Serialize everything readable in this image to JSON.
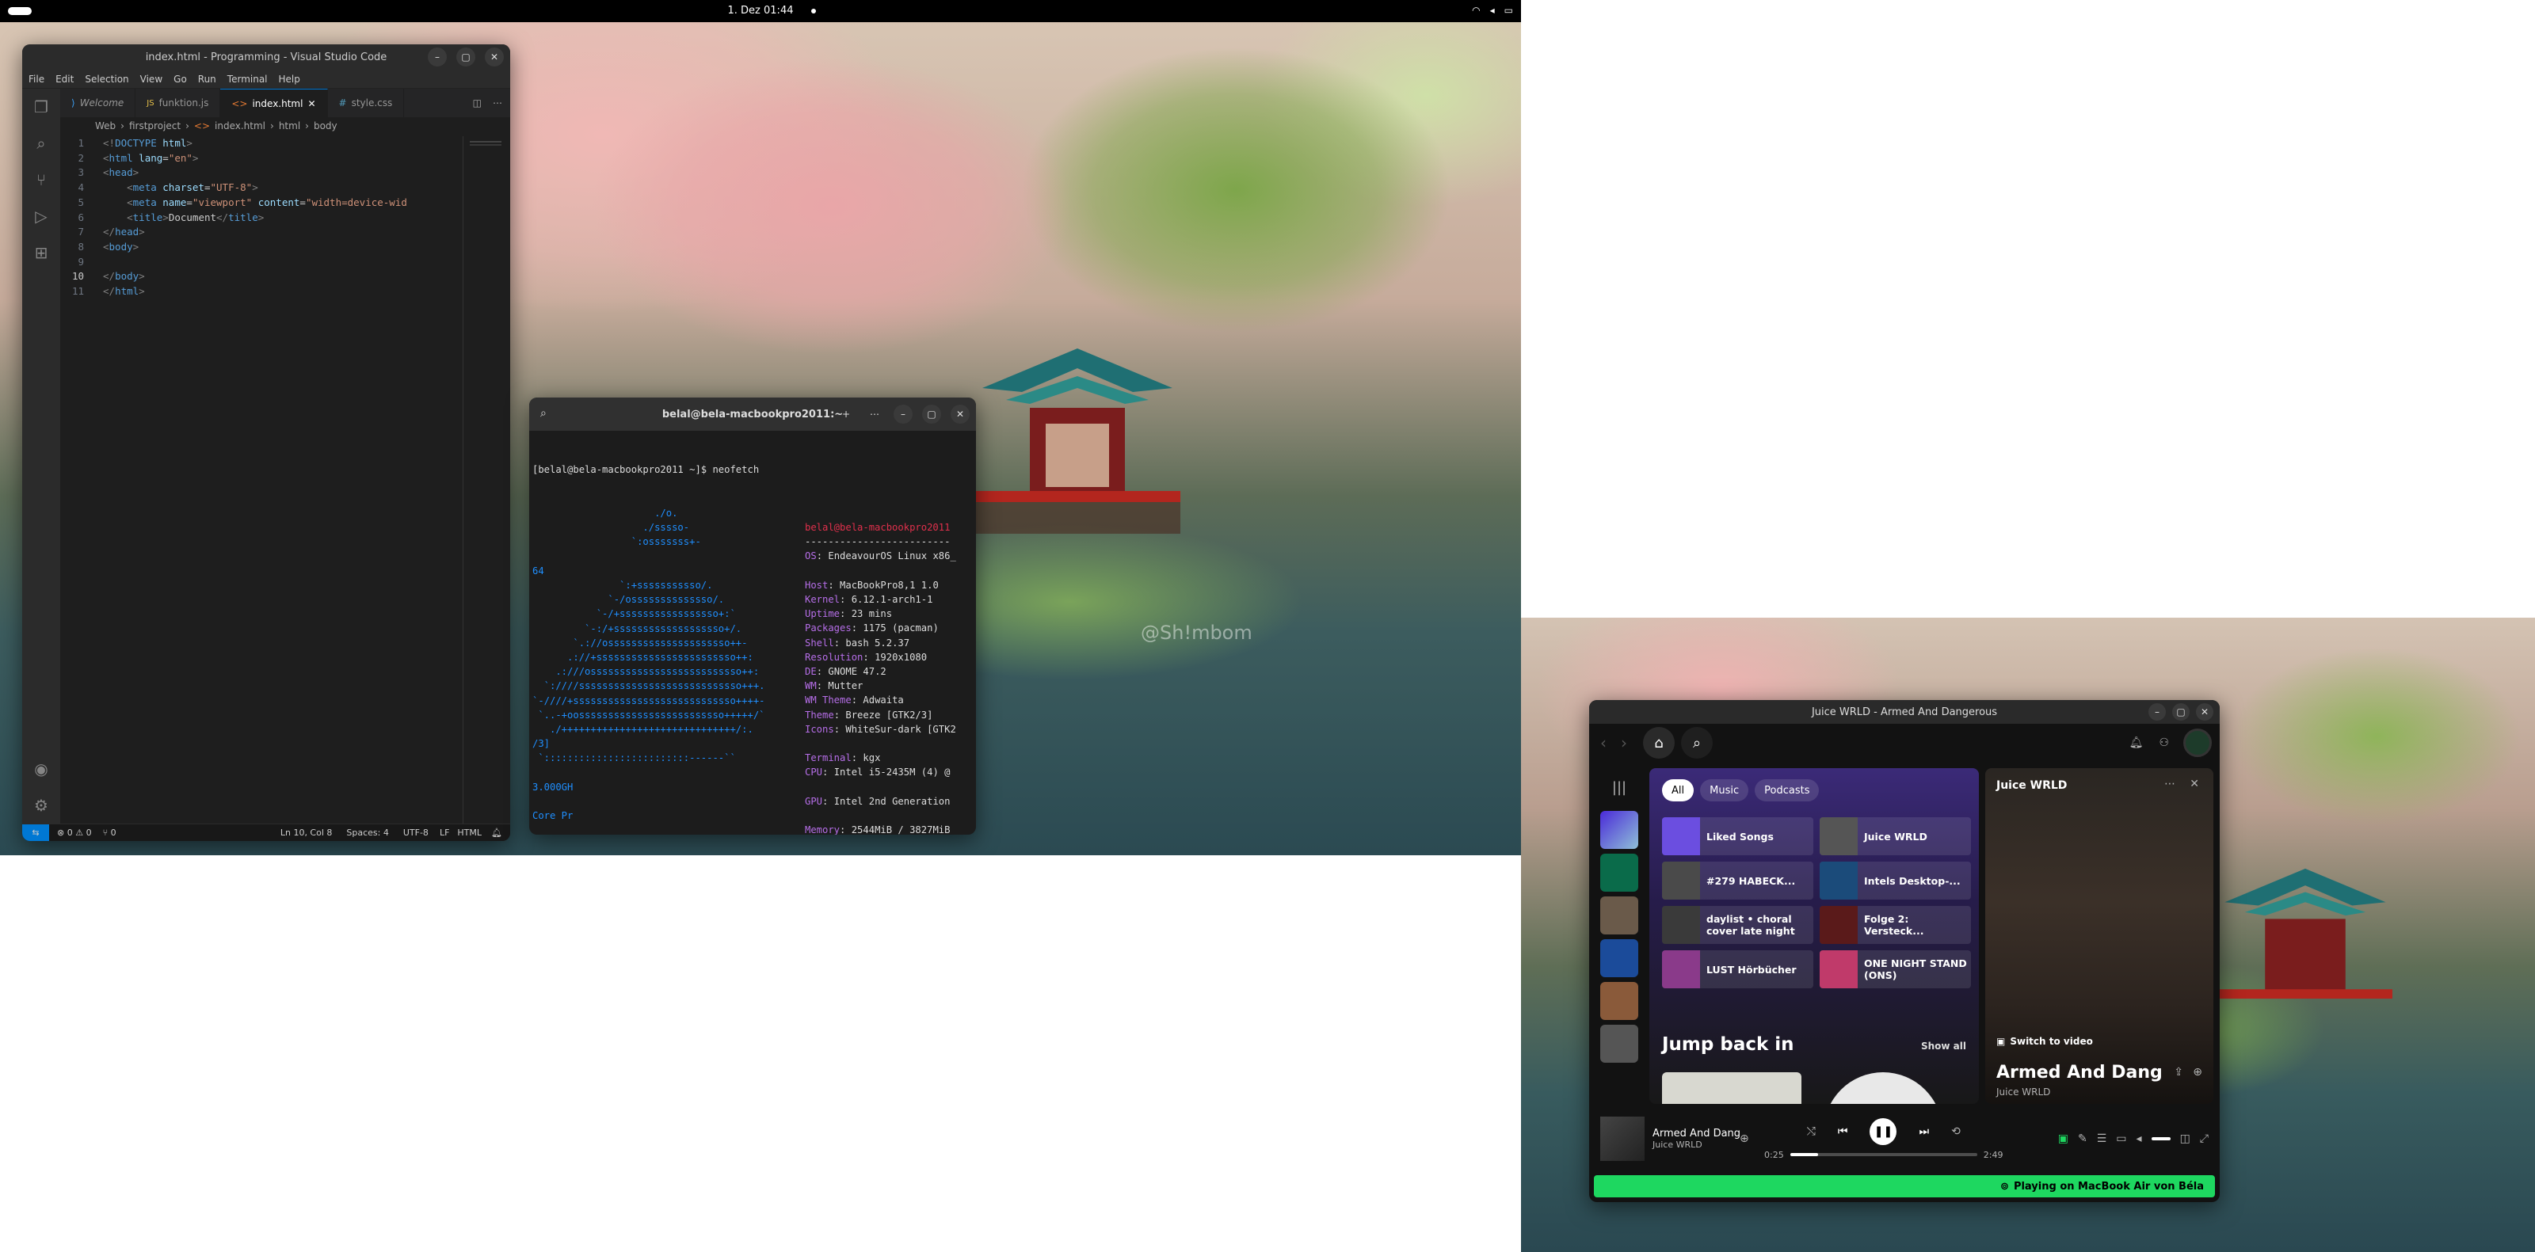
{
  "topbar": {
    "clock": "1. Dez  01:44"
  },
  "wallpaper_watermark": "@Sh!mbom",
  "vscode": {
    "title": "index.html - Programming - Visual Studio Code",
    "menu": [
      "File",
      "Edit",
      "Selection",
      "View",
      "Go",
      "Run",
      "Terminal",
      "Help"
    ],
    "tabs": [
      "Welcome",
      "funktion.js",
      "index.html",
      "style.css"
    ],
    "breadcrumb": [
      "Web",
      "firstproject",
      "index.html",
      "html",
      "body"
    ],
    "lines": [
      {
        "n": "1",
        "html": "<span class='pl'>&lt;!</span><span class='tg'>DOCTYPE</span> <span class='at'>html</span><span class='pl'>&gt;</span>"
      },
      {
        "n": "2",
        "html": "<span class='pl'>&lt;</span><span class='tg'>html</span> <span class='at'>lang</span>=<span class='st'>\"en\"</span><span class='pl'>&gt;</span>"
      },
      {
        "n": "3",
        "html": "<span class='pl'>&lt;</span><span class='tg'>head</span><span class='pl'>&gt;</span>"
      },
      {
        "n": "4",
        "html": "    <span class='pl'>&lt;</span><span class='tg'>meta</span> <span class='at'>charset</span>=<span class='st'>\"UTF-8\"</span><span class='pl'>&gt;</span>"
      },
      {
        "n": "5",
        "html": "    <span class='pl'>&lt;</span><span class='tg'>meta</span> <span class='at'>name</span>=<span class='st'>\"viewport\"</span> <span class='at'>content</span>=<span class='st'>\"width=device-wid</span>"
      },
      {
        "n": "6",
        "html": "    <span class='pl'>&lt;</span><span class='tg'>title</span><span class='pl'>&gt;</span>Document<span class='pl'>&lt;/</span><span class='tg'>title</span><span class='pl'>&gt;</span>"
      },
      {
        "n": "7",
        "html": "<span class='pl'>&lt;/</span><span class='tg'>head</span><span class='pl'>&gt;</span>"
      },
      {
        "n": "8",
        "html": "<span class='pl'>&lt;</span><span class='tg'>body</span><span class='pl'>&gt;</span>"
      },
      {
        "n": "9",
        "html": ""
      },
      {
        "n": "10",
        "html": "<span class='pl'>&lt;/</span><span class='tg'>body</span><span class='pl'>&gt;</span>"
      },
      {
        "n": "11",
        "html": "<span class='pl'>&lt;/</span><span class='tg'>html</span><span class='pl'>&gt;</span>"
      }
    ],
    "status": {
      "problems": "⊗ 0 ⚠ 0",
      "ports": "⑂ 0",
      "position": "Ln 10, Col 8",
      "spaces": "Spaces: 4",
      "encoding": "UTF-8",
      "eol": "LF",
      "language": "HTML"
    }
  },
  "terminal": {
    "title": "belal@bela-macbookpro2011:~",
    "prompt": "[belal@bela-macbookpro2011 ~]$ neofetch",
    "logo": "                     ./o.\n                   ./sssso-\n                 `:osssssss+-\n\n64\n               `:+sssssssssso/.\n             `-/ossssssssssssso/.\n           `-/+sssssssssssssssso+:`\n         `-:/+sssssssssssssssssso+/.\n       `.://osssssssssssssssssssso++-\n      .://+ssssssssssssssssssssssso++:\n    .:///ossssssssssssssssssssssssso++:\n  `:////ssssssssssssssssssssssssssso+++.\n`-////+ssssssssssssssssssssssssssso++++-\n `..-+oosssssssssssssssssssssssso+++++/`\n   ./++++++++++++++++++++++++++++++/:.\n/3]\n `:::::::::::::::::::::::::------``\n\n3.000GH\n\nCore Pr",
    "info": [
      {
        "k": "",
        "v": "belal@bela-macbookpro2011",
        "red": true
      },
      {
        "k": "",
        "v": "-------------------------"
      },
      {
        "k": "OS",
        "v": "EndeavourOS Linux x86_"
      },
      {
        "k": "",
        "v": ""
      },
      {
        "k": "Host",
        "v": "MacBookPro8,1 1.0"
      },
      {
        "k": "Kernel",
        "v": "6.12.1-arch1-1"
      },
      {
        "k": "Uptime",
        "v": "23 mins"
      },
      {
        "k": "Packages",
        "v": "1175 (pacman)"
      },
      {
        "k": "Shell",
        "v": "bash 5.2.37"
      },
      {
        "k": "Resolution",
        "v": "1920x1080"
      },
      {
        "k": "DE",
        "v": "GNOME 47.2"
      },
      {
        "k": "WM",
        "v": "Mutter"
      },
      {
        "k": "WM Theme",
        "v": "Adwaita"
      },
      {
        "k": "Theme",
        "v": "Breeze [GTK2/3]"
      },
      {
        "k": "Icons",
        "v": "WhiteSur-dark [GTK2"
      },
      {
        "k": "",
        "v": ""
      },
      {
        "k": "Terminal",
        "v": "kgx"
      },
      {
        "k": "CPU",
        "v": "Intel i5-2435M (4) @"
      },
      {
        "k": "",
        "v": ""
      },
      {
        "k": "GPU",
        "v": "Intel 2nd Generation"
      },
      {
        "k": "",
        "v": ""
      },
      {
        "k": "Memory",
        "v": "2544MiB / 3827MiB"
      }
    ],
    "palette": [
      "#555555",
      "#e0304c",
      "#26d07c",
      "#e6c229",
      "#2f8cf5",
      "#b66ee8",
      "#22c7d9",
      "#f2f2f2"
    ]
  },
  "spotify": {
    "title": "Juice WRLD - Armed And Dangerous",
    "chips": [
      "All",
      "Music",
      "Podcasts"
    ],
    "grid": [
      {
        "label": "Liked Songs",
        "color": "#6b4ee0"
      },
      {
        "label": "Juice WRLD",
        "color": "#555"
      },
      {
        "label": "#279 HABECK...",
        "color": "#4a4a4a"
      },
      {
        "label": "Intels Desktop-...",
        "color": "#1b4b7a"
      },
      {
        "label": "daylist • choral cover late night",
        "color": "#3a3a3a"
      },
      {
        "label": "Folge 2: Versteck...",
        "color": "#5a1a1a"
      },
      {
        "label": "LUST Hörbücher",
        "color": "#8a3a8a"
      },
      {
        "label": "ONE NIGHT STAND (ONS)",
        "color": "#c03a6a"
      }
    ],
    "jump_back_in": "Jump back in",
    "show_all": "Show all",
    "np_artist": "Juice WRLD",
    "switch_video": "Switch to video",
    "np_song": "Armed And Dang",
    "np_artist_small": "Juice WRLD",
    "track_name": "Armed And Dange",
    "track_artist": "Juice WRLD",
    "time_elapsed": "0:25",
    "time_total": "2:49",
    "progress": 0.15,
    "device": "Playing on MacBook Air von Béla"
  }
}
